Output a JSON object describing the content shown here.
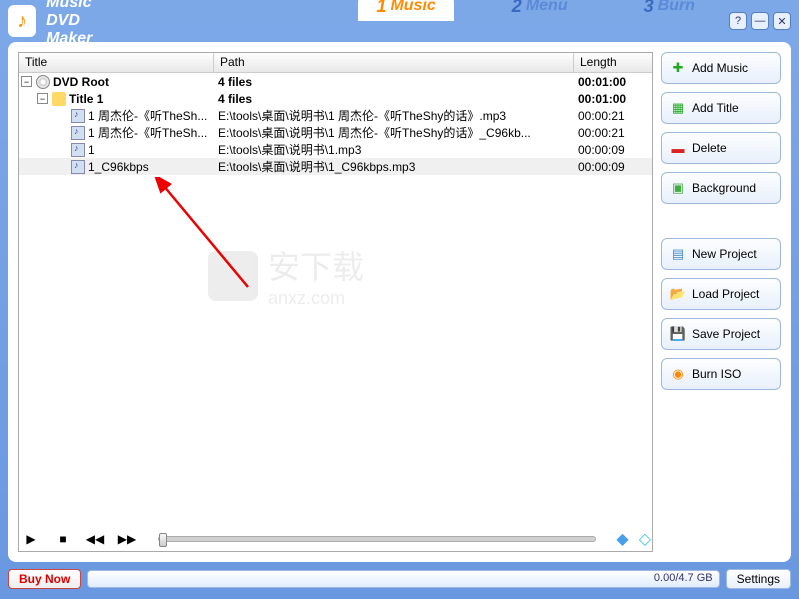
{
  "app": {
    "title": "Music DVD Maker"
  },
  "tabs": [
    {
      "num": "1",
      "label": "Music"
    },
    {
      "num": "2",
      "label": "Menu"
    },
    {
      "num": "3",
      "label": "Burn"
    }
  ],
  "columns": {
    "title": "Title",
    "path": "Path",
    "length": "Length"
  },
  "tree": {
    "root": {
      "title": "DVD Root",
      "path": "4 files",
      "length": "00:01:00"
    },
    "title1": {
      "title": "Title 1",
      "path": "4 files",
      "length": "00:01:00"
    },
    "files": [
      {
        "title": "1 周杰伦-《听TheSh...",
        "path": "E:\\tools\\桌面\\说明书\\1 周杰伦-《听TheShy的话》.mp3",
        "length": "00:00:21"
      },
      {
        "title": "1 周杰伦-《听TheSh...",
        "path": "E:\\tools\\桌面\\说明书\\1 周杰伦-《听TheShy的话》_C96kb...",
        "length": "00:00:21"
      },
      {
        "title": "1",
        "path": "E:\\tools\\桌面\\说明书\\1.mp3",
        "length": "00:00:09"
      },
      {
        "title": "1_C96kbps",
        "path": "E:\\tools\\桌面\\说明书\\1_C96kbps.mp3",
        "length": "00:00:09"
      }
    ]
  },
  "buttons": {
    "addMusic": "Add Music",
    "addTitle": "Add Title",
    "delete": "Delete",
    "background": "Background",
    "newProject": "New Project",
    "loadProject": "Load Project",
    "saveProject": "Save Project",
    "burnISO": "Burn ISO"
  },
  "bottom": {
    "buyNow": "Buy Now",
    "progress": "0.00/4.7 GB",
    "settings": "Settings"
  },
  "watermark": {
    "text": "安下载",
    "sub": "anxz.com"
  }
}
